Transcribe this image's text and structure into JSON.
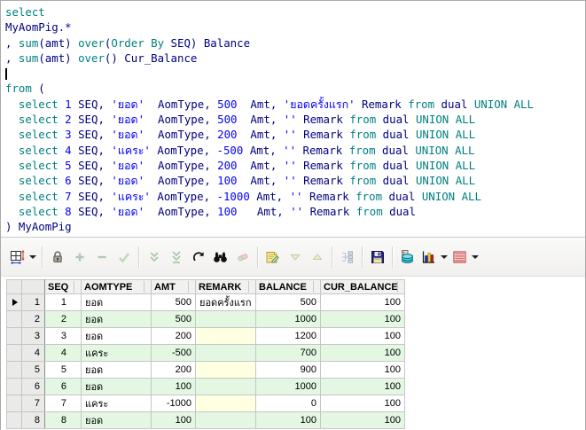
{
  "colors": {
    "keyword": "#008080",
    "identifier": "#000080",
    "literal": "#0000FF",
    "row_stripe": "#E3F7E3",
    "null_cell": "#FFFFE1",
    "grid_line": "#C6C6C6",
    "toolbar_bg": "#F1F0EE"
  },
  "editor": {
    "lines": [
      [
        [
          "k",
          "select"
        ]
      ],
      [
        [
          "i",
          "MyAomPig.*"
        ]
      ],
      [
        [
          "i",
          ", "
        ],
        [
          "k",
          "sum"
        ],
        [
          "i",
          "(amt) "
        ],
        [
          "k",
          "over"
        ],
        [
          "i",
          "("
        ],
        [
          "k",
          "Order By"
        ],
        [
          "i",
          " SEQ) Balance"
        ]
      ],
      [
        [
          "i",
          ", "
        ],
        [
          "k",
          "sum"
        ],
        [
          "i",
          "(amt) "
        ],
        [
          "k",
          "over"
        ],
        [
          "i",
          "() Cur_Balance"
        ]
      ],
      [
        [
          "c",
          ""
        ]
      ],
      [
        [
          "k",
          "from"
        ],
        [
          "i",
          " ("
        ]
      ],
      [
        [
          "i",
          "  "
        ],
        [
          "k",
          "select"
        ],
        [
          "i",
          " "
        ],
        [
          "n",
          "1"
        ],
        [
          "i",
          " SEQ, "
        ],
        [
          "s",
          "'ยอด'"
        ],
        [
          "i",
          "  AomType, "
        ],
        [
          "n",
          "500"
        ],
        [
          "i",
          "  Amt, "
        ],
        [
          "s",
          "'ยอดครั้งแรก'"
        ],
        [
          "i",
          " Remark "
        ],
        [
          "k",
          "from"
        ],
        [
          "i",
          " dual "
        ],
        [
          "k",
          "UNION ALL"
        ]
      ],
      [
        [
          "i",
          "  "
        ],
        [
          "k",
          "select"
        ],
        [
          "i",
          " "
        ],
        [
          "n",
          "2"
        ],
        [
          "i",
          " SEQ, "
        ],
        [
          "s",
          "'ยอด'"
        ],
        [
          "i",
          "  AomType, "
        ],
        [
          "n",
          "500"
        ],
        [
          "i",
          "  Amt, "
        ],
        [
          "s",
          "''"
        ],
        [
          "i",
          " Remark "
        ],
        [
          "k",
          "from"
        ],
        [
          "i",
          " dual "
        ],
        [
          "k",
          "UNION ALL"
        ]
      ],
      [
        [
          "i",
          "  "
        ],
        [
          "k",
          "select"
        ],
        [
          "i",
          " "
        ],
        [
          "n",
          "3"
        ],
        [
          "i",
          " SEQ, "
        ],
        [
          "s",
          "'ยอด'"
        ],
        [
          "i",
          "  AomType, "
        ],
        [
          "n",
          "200"
        ],
        [
          "i",
          "  Amt, "
        ],
        [
          "s",
          "''"
        ],
        [
          "i",
          " Remark "
        ],
        [
          "k",
          "from"
        ],
        [
          "i",
          " dual "
        ],
        [
          "k",
          "UNION ALL"
        ]
      ],
      [
        [
          "i",
          "  "
        ],
        [
          "k",
          "select"
        ],
        [
          "i",
          " "
        ],
        [
          "n",
          "4"
        ],
        [
          "i",
          " SEQ, "
        ],
        [
          "s",
          "'แคระ'"
        ],
        [
          "i",
          " AomType, "
        ],
        [
          "n",
          "-500"
        ],
        [
          "i",
          " Amt, "
        ],
        [
          "s",
          "''"
        ],
        [
          "i",
          " Remark "
        ],
        [
          "k",
          "from"
        ],
        [
          "i",
          " dual "
        ],
        [
          "k",
          "UNION ALL"
        ]
      ],
      [
        [
          "i",
          "  "
        ],
        [
          "k",
          "select"
        ],
        [
          "i",
          " "
        ],
        [
          "n",
          "5"
        ],
        [
          "i",
          " SEQ, "
        ],
        [
          "s",
          "'ยอด'"
        ],
        [
          "i",
          "  AomType, "
        ],
        [
          "n",
          "200"
        ],
        [
          "i",
          "  Amt, "
        ],
        [
          "s",
          "''"
        ],
        [
          "i",
          " Remark "
        ],
        [
          "k",
          "from"
        ],
        [
          "i",
          " dual "
        ],
        [
          "k",
          "UNION ALL"
        ]
      ],
      [
        [
          "i",
          "  "
        ],
        [
          "k",
          "select"
        ],
        [
          "i",
          " "
        ],
        [
          "n",
          "6"
        ],
        [
          "i",
          " SEQ, "
        ],
        [
          "s",
          "'ยอด'"
        ],
        [
          "i",
          "  AomType, "
        ],
        [
          "n",
          "100"
        ],
        [
          "i",
          "  Amt, "
        ],
        [
          "s",
          "''"
        ],
        [
          "i",
          " Remark "
        ],
        [
          "k",
          "from"
        ],
        [
          "i",
          " dual "
        ],
        [
          "k",
          "UNION ALL"
        ]
      ],
      [
        [
          "i",
          "  "
        ],
        [
          "k",
          "select"
        ],
        [
          "i",
          " "
        ],
        [
          "n",
          "7"
        ],
        [
          "i",
          " SEQ, "
        ],
        [
          "s",
          "'แคระ'"
        ],
        [
          "i",
          " AomType, "
        ],
        [
          "n",
          "-1000"
        ],
        [
          "i",
          " Amt, "
        ],
        [
          "s",
          "''"
        ],
        [
          "i",
          " Remark "
        ],
        [
          "k",
          "from"
        ],
        [
          "i",
          " dual "
        ],
        [
          "k",
          "UNION ALL"
        ]
      ],
      [
        [
          "i",
          "  "
        ],
        [
          "k",
          "select"
        ],
        [
          "i",
          " "
        ],
        [
          "n",
          "8"
        ],
        [
          "i",
          " SEQ, "
        ],
        [
          "s",
          "'ยอด'"
        ],
        [
          "i",
          "  AomType, "
        ],
        [
          "n",
          "100"
        ],
        [
          "i",
          "   Amt, "
        ],
        [
          "s",
          "''"
        ],
        [
          "i",
          " Remark "
        ],
        [
          "k",
          "from"
        ],
        [
          "i",
          " dual"
        ]
      ],
      [
        [
          "i",
          ") MyAomPig"
        ]
      ]
    ]
  },
  "toolbar": {
    "buttons": [
      {
        "name": "grid-options",
        "icon": "grid",
        "enabled": true,
        "dropdown": true
      },
      {
        "sep": true
      },
      {
        "name": "lock",
        "icon": "lock",
        "enabled": true
      },
      {
        "name": "insert-record",
        "icon": "plus",
        "enabled": false
      },
      {
        "name": "delete-record",
        "icon": "minus",
        "enabled": false
      },
      {
        "name": "post-edit",
        "icon": "check",
        "enabled": false
      },
      {
        "sep": true
      },
      {
        "name": "fetch-next-page",
        "icon": "chevrons-down",
        "enabled": false
      },
      {
        "name": "fetch-all",
        "icon": "chevrons-down-bar",
        "enabled": false
      },
      {
        "name": "refresh",
        "icon": "refresh",
        "enabled": true
      },
      {
        "name": "find",
        "icon": "binoculars",
        "enabled": true
      },
      {
        "name": "erase",
        "icon": "eraser",
        "enabled": false
      },
      {
        "sep": true
      },
      {
        "name": "export-data",
        "icon": "export",
        "enabled": true
      },
      {
        "name": "move-down",
        "icon": "triangle-down",
        "enabled": false
      },
      {
        "name": "move-up",
        "icon": "triangle-up",
        "enabled": false
      },
      {
        "sep": true
      },
      {
        "name": "group-records",
        "icon": "tree",
        "enabled": false
      },
      {
        "sep": true
      },
      {
        "name": "save",
        "icon": "save",
        "enabled": true
      },
      {
        "sep": true
      },
      {
        "name": "dataset",
        "icon": "database",
        "enabled": true
      },
      {
        "name": "chart",
        "icon": "chart",
        "enabled": true,
        "dropdown": true
      },
      {
        "name": "pivot-grid",
        "icon": "red-table",
        "enabled": true,
        "dropdown": true
      }
    ]
  },
  "grid": {
    "columns": [
      {
        "key": "seq",
        "label": "SEQ",
        "align": "right"
      },
      {
        "key": "aomtype",
        "label": "AOMTYPE",
        "align": "left"
      },
      {
        "key": "amt",
        "label": "AMT",
        "align": "right"
      },
      {
        "key": "remark",
        "label": "REMARK",
        "align": "left"
      },
      {
        "key": "balance",
        "label": "BALANCE",
        "align": "right"
      },
      {
        "key": "cur_balance",
        "label": "CUR_BALANCE",
        "align": "right"
      }
    ],
    "rows": [
      {
        "row": "1",
        "selected": true,
        "seq": "1",
        "aomtype": "ยอด",
        "amt": "500",
        "remark": "ยอดครั้งแรก",
        "balance": "500",
        "cur_balance": "100"
      },
      {
        "row": "2",
        "selected": false,
        "seq": "2",
        "aomtype": "ยอด",
        "amt": "500",
        "remark": "",
        "balance": "1000",
        "cur_balance": "100"
      },
      {
        "row": "3",
        "selected": false,
        "seq": "3",
        "aomtype": "ยอด",
        "amt": "200",
        "remark": "",
        "balance": "1200",
        "cur_balance": "100"
      },
      {
        "row": "4",
        "selected": false,
        "seq": "4",
        "aomtype": "แคระ",
        "amt": "-500",
        "remark": "",
        "balance": "700",
        "cur_balance": "100"
      },
      {
        "row": "5",
        "selected": false,
        "seq": "5",
        "aomtype": "ยอด",
        "amt": "200",
        "remark": "",
        "balance": "900",
        "cur_balance": "100"
      },
      {
        "row": "6",
        "selected": false,
        "seq": "6",
        "aomtype": "ยอด",
        "amt": "100",
        "remark": "",
        "balance": "1000",
        "cur_balance": "100"
      },
      {
        "row": "7",
        "selected": false,
        "seq": "7",
        "aomtype": "แคระ",
        "amt": "-1000",
        "remark": "",
        "balance": "0",
        "cur_balance": "100"
      },
      {
        "row": "8",
        "selected": false,
        "seq": "8",
        "aomtype": "ยอด",
        "amt": "100",
        "remark": "",
        "balance": "100",
        "cur_balance": "100"
      }
    ]
  }
}
